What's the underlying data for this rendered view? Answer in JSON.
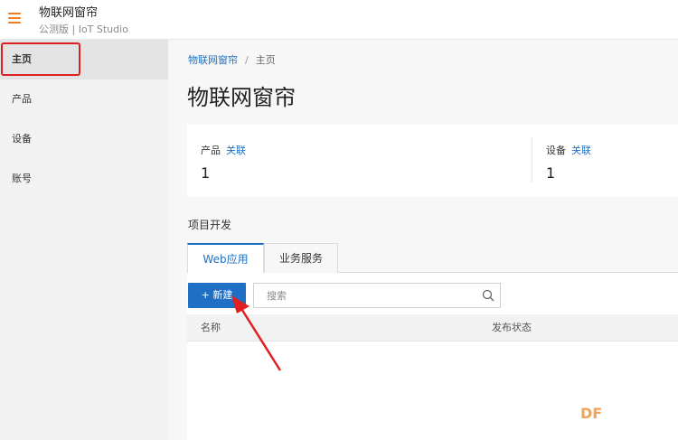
{
  "app": {
    "title": "物联网窗帘",
    "subtitle": "公测版 | IoT Studio",
    "menu_icon": "hamburger-icon"
  },
  "sidebar": {
    "items": [
      {
        "label": "主页",
        "active": true
      },
      {
        "label": "产品",
        "active": false
      },
      {
        "label": "设备",
        "active": false
      },
      {
        "label": "账号",
        "active": false
      }
    ]
  },
  "breadcrumb": {
    "project": "物联网窗帘",
    "separator": "/",
    "current": "主页"
  },
  "page": {
    "title": "物联网窗帘"
  },
  "stats": {
    "product": {
      "label": "产品",
      "link": "关联",
      "value": "1"
    },
    "device": {
      "label": "设备",
      "link": "关联",
      "value": "1"
    }
  },
  "project_dev": {
    "title": "项目开发",
    "tabs": [
      {
        "label": "Web应用",
        "active": true
      },
      {
        "label": "业务服务",
        "active": false
      }
    ],
    "new_button": "+ 新建",
    "search_placeholder": "搜索",
    "columns": [
      "名称",
      "发布状态"
    ]
  },
  "watermark": "DF",
  "colors": {
    "accent": "#1e6fc4",
    "brand_orange": "#f47a1f",
    "annotation_red": "#e02020"
  }
}
